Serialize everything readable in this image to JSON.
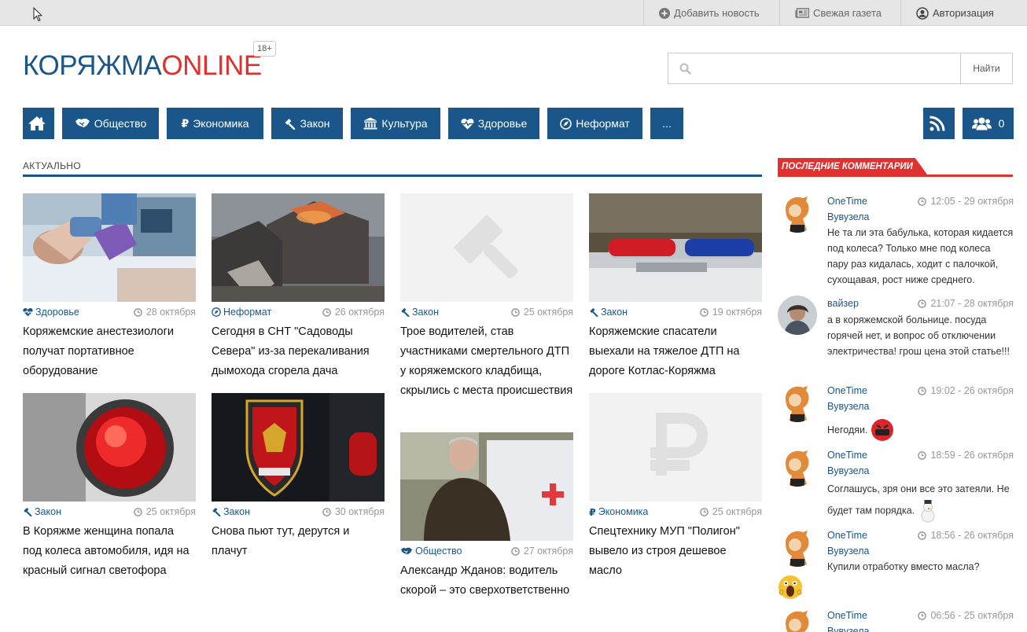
{
  "topbar": {
    "add_news": "Добавить новость",
    "newspaper": "Свежая газета",
    "login": "Авторизация"
  },
  "logo": {
    "part1": "КОРЯЖМА",
    "part2": "ONLINE",
    "age": "18+"
  },
  "search": {
    "placeholder": "",
    "button": "Найти"
  },
  "nav": {
    "items": [
      "Общество",
      "Экономика",
      "Закон",
      "Культура",
      "Здоровье",
      "Неформат",
      "..."
    ],
    "users_count": "0"
  },
  "section": {
    "title": "АКТУАЛЬНО"
  },
  "articles": [
    {
      "category": "Здоровье",
      "date": "28 октября",
      "title": "Коряжемские анестезиологи получат портативное оборудование"
    },
    {
      "category": "Неформат",
      "date": "26 октября",
      "title": "Сегодня в СНТ \"Садоводы Севера\" из-за перекаливания дымохода сгорела дача"
    },
    {
      "category": "Закон",
      "date": "25 октября",
      "title": "Трое водителей, став участниками смертельного ДТП у коряжемского кладбища, скрылись с места происшествия"
    },
    {
      "category": "Закон",
      "date": "19 октября",
      "title": "Коряжемские спасатели выехали на тяжелое ДТП на дороге Котлас-Коряжма"
    },
    {
      "category": "Закон",
      "date": "25 октября",
      "title": "В Коряжме женщина попала под колеса автомобиля, идя на красный сигнал светофора"
    },
    {
      "category": "Закон",
      "date": "30 октября",
      "title": "Снова пьют тут, дерутся и плачут"
    },
    {
      "category": "Общество",
      "date": "27 октября",
      "title": "Александр Жданов: водитель скорой – это сверхответственно"
    },
    {
      "category": "Экономика",
      "date": "25 октября",
      "title": "Спецтехнику МУП \"Полигон\" вывело из строя дешевое масло"
    }
  ],
  "sidebar": {
    "title": "ПОСЛЕДНИЕ КОММЕНТАРИИ",
    "comments": [
      {
        "name": "OneTime Вувузела",
        "time": "12:05 - 29 октября",
        "text": "Не та ли эта бабулька, которая кидается под колеса? Только мне под колеса пару раз кидалась, ходит с палочкой, сухощавая, рост ниже среднего."
      },
      {
        "name": "вайзер",
        "time": "21:07 - 28 октября",
        "text": "а в коряжемской больнице. посуда горячей нет, и вопрос об отключении электричества! грош цена этой статье!!!"
      },
      {
        "name": "OneTime Вувузела",
        "time": "19:02 - 26 октября",
        "text": "Негодяи."
      },
      {
        "name": "OneTime Вувузела",
        "time": "18:59 - 26 октября",
        "text": "Соглашусь, зря они все это затеяли. Не будет там порядка."
      },
      {
        "name": "OneTime Вувузела",
        "time": "18:56 - 26 октября",
        "text": "Купили отработку вместо масла?"
      },
      {
        "name": "OneTime Вувузела",
        "time": "06:56 - 25 октября",
        "text": ""
      }
    ]
  },
  "colors": {
    "primary": "#1a568a",
    "accent": "#e0302f"
  }
}
